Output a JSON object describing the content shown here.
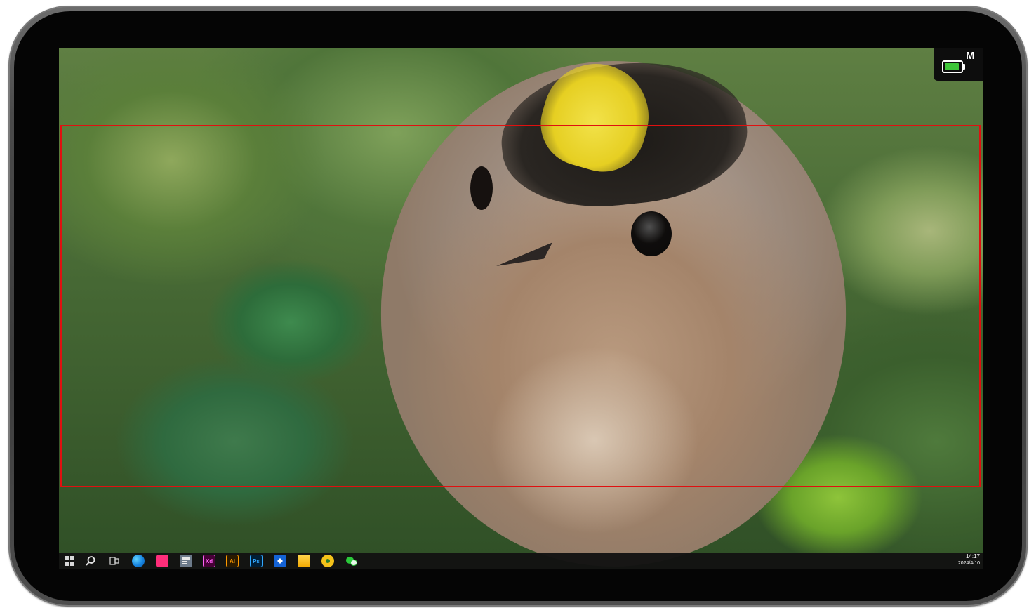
{
  "device": {
    "battery": {
      "mode_letter": "M",
      "level_fraction": 0.9,
      "fill_color": "#3fc63a"
    },
    "selection_color": "#e01010"
  },
  "taskbar": {
    "icons": [
      {
        "name": "windows-start-icon"
      },
      {
        "name": "search-icon"
      },
      {
        "name": "task-view-icon"
      },
      {
        "name": "edge-browser-icon"
      },
      {
        "name": "pink-app-icon"
      },
      {
        "name": "calculator-icon"
      },
      {
        "name": "adobe-xd-icon",
        "label": "Xd"
      },
      {
        "name": "adobe-illustrator-icon",
        "label": "Ai"
      },
      {
        "name": "adobe-photoshop-icon",
        "label": "Ps"
      },
      {
        "name": "blue-app-icon"
      },
      {
        "name": "file-explorer-icon"
      },
      {
        "name": "yellow-app-icon"
      },
      {
        "name": "wechat-icon"
      }
    ],
    "clock": {
      "time": "14:17",
      "date": "2024/4/10"
    }
  }
}
